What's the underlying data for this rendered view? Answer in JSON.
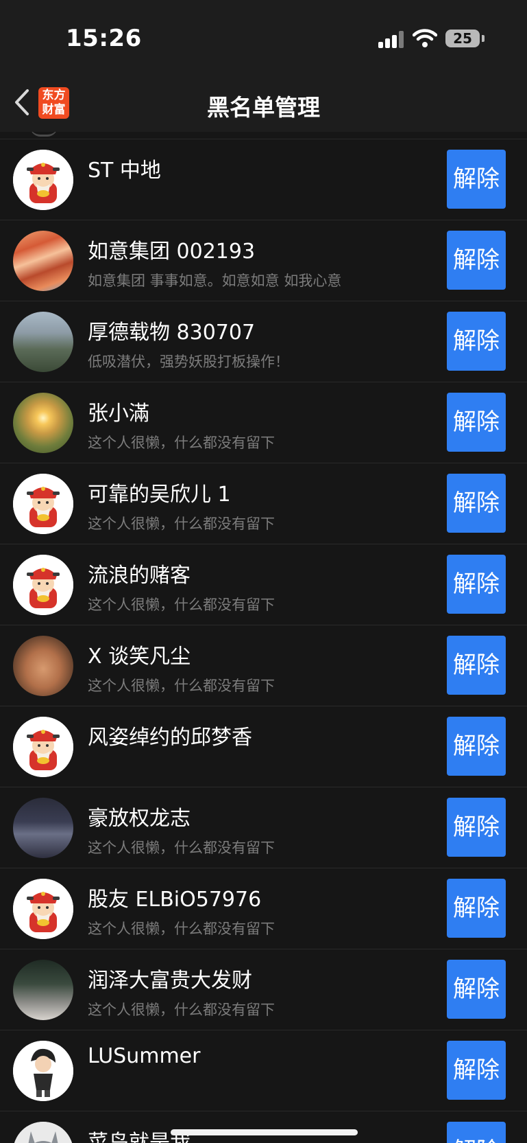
{
  "status_bar": {
    "time": "15:26",
    "battery": "25"
  },
  "nav": {
    "logo_line1": "东方",
    "logo_line2": "财富",
    "title": "黑名单管理"
  },
  "accent_color": "#2f7ef2",
  "items": [
    {
      "name": "ST 中地",
      "signature": "",
      "avatar": "caishen-avatar",
      "button": "解除"
    },
    {
      "name": "如意集团 002193",
      "signature": "如意集团 事事如意。如意如意 如我心意",
      "avatar": "red-canyon-photo",
      "button": "解除"
    },
    {
      "name": "厚德载物 830707",
      "signature": "低吸潜伏，强势妖股打板操作！",
      "avatar": "mountain-photo",
      "button": "解除"
    },
    {
      "name": "张小滿",
      "signature": "这个人很懒，什么都没有留下",
      "avatar": "sunset-photo",
      "button": "解除"
    },
    {
      "name": "可靠的吴欣儿 1",
      "signature": "这个人很懒，什么都没有留下",
      "avatar": "caishen-avatar",
      "button": "解除"
    },
    {
      "name": "流浪的赌客",
      "signature": "这个人很懒，什么都没有留下",
      "avatar": "caishen-avatar",
      "button": "解除"
    },
    {
      "name": "X 谈笑凡尘",
      "signature": "这个人很懒，什么都没有留下",
      "avatar": "hamster-photo",
      "button": "解除"
    },
    {
      "name": "风姿绰约的邱梦香",
      "signature": "",
      "avatar": "caishen-avatar",
      "button": "解除"
    },
    {
      "name": "豪放权龙志",
      "signature": "这个人很懒，什么都没有留下",
      "avatar": "girl-photo",
      "button": "解除"
    },
    {
      "name": "股友 ELBiO57976",
      "signature": "这个人很懒，什么都没有留下",
      "avatar": "caishen-avatar",
      "button": "解除"
    },
    {
      "name": "润泽大富贵大发财",
      "signature": "这个人很懒，什么都没有留下",
      "avatar": "man-photo",
      "button": "解除"
    },
    {
      "name": "LUSummer",
      "signature": "",
      "avatar": "cartoon-boy-avatar",
      "button": "解除"
    },
    {
      "name": "菜鸟就是我",
      "signature": "",
      "avatar": "totoro-avatar",
      "button": "解除"
    }
  ]
}
